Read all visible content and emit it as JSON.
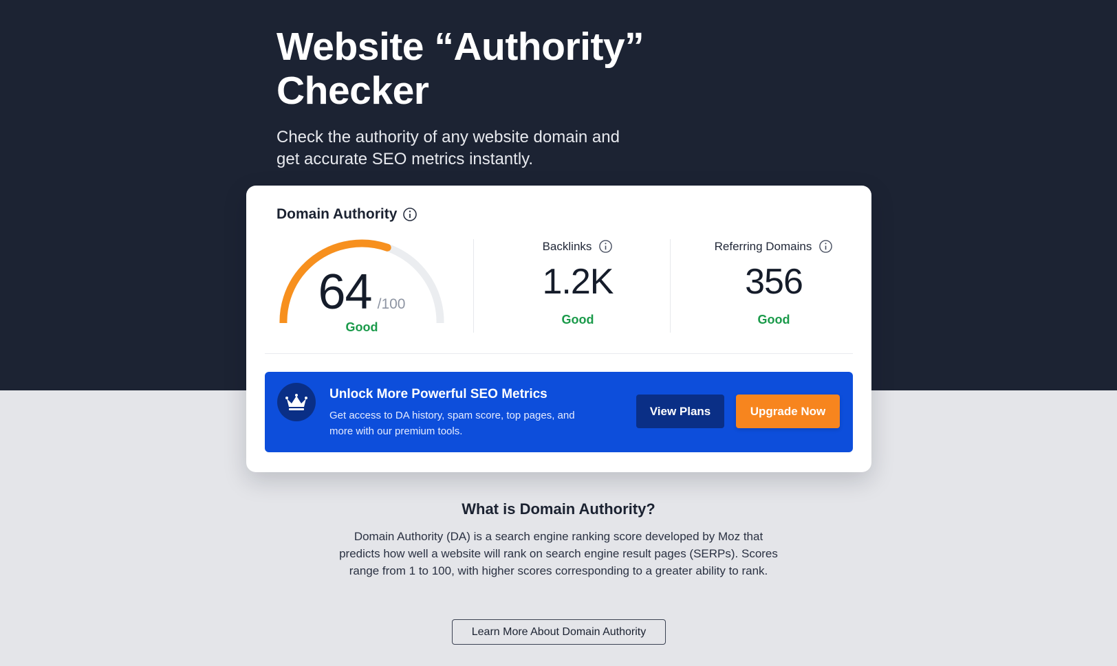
{
  "hero": {
    "title_line1": "Website “Authority”",
    "title_line2": "Checker",
    "subtitle": "Check the authority of any website domain and get accurate SEO metrics instantly."
  },
  "card": {
    "title": "Domain Authority",
    "title_icon": "info-icon",
    "gauge": {
      "value": "64",
      "max_label": "/100",
      "score": 64,
      "max": 100,
      "status": "Good",
      "color_fill": "#f7901e",
      "color_track": "#ebedf0"
    },
    "metrics": [
      {
        "label": "Backlinks",
        "icon": "info-icon",
        "value": "1.2K",
        "status": "Good"
      },
      {
        "label": "Referring Domains",
        "icon": "info-icon",
        "value": "356",
        "status": "Good"
      }
    ],
    "status_color": "#1a9a4a"
  },
  "promo": {
    "icon": "crown-icon",
    "title": "Unlock More Powerful SEO Metrics",
    "description": "Get access to DA history, spam score, top pages, and more with our premium tools.",
    "view_plans_label": "View Plans",
    "upgrade_label": "Upgrade Now",
    "background": "#0d4edb",
    "accent": "#f7851e"
  },
  "about": {
    "heading": "What is Domain Authority?",
    "body": "Domain Authority (DA) is a search engine ranking score developed by Moz that predicts how well a website will rank on search engine result pages (SERPs). Scores range from 1 to 100, with higher scores corresponding to a greater ability to rank.",
    "button_label": "Learn More About Domain Authority"
  }
}
